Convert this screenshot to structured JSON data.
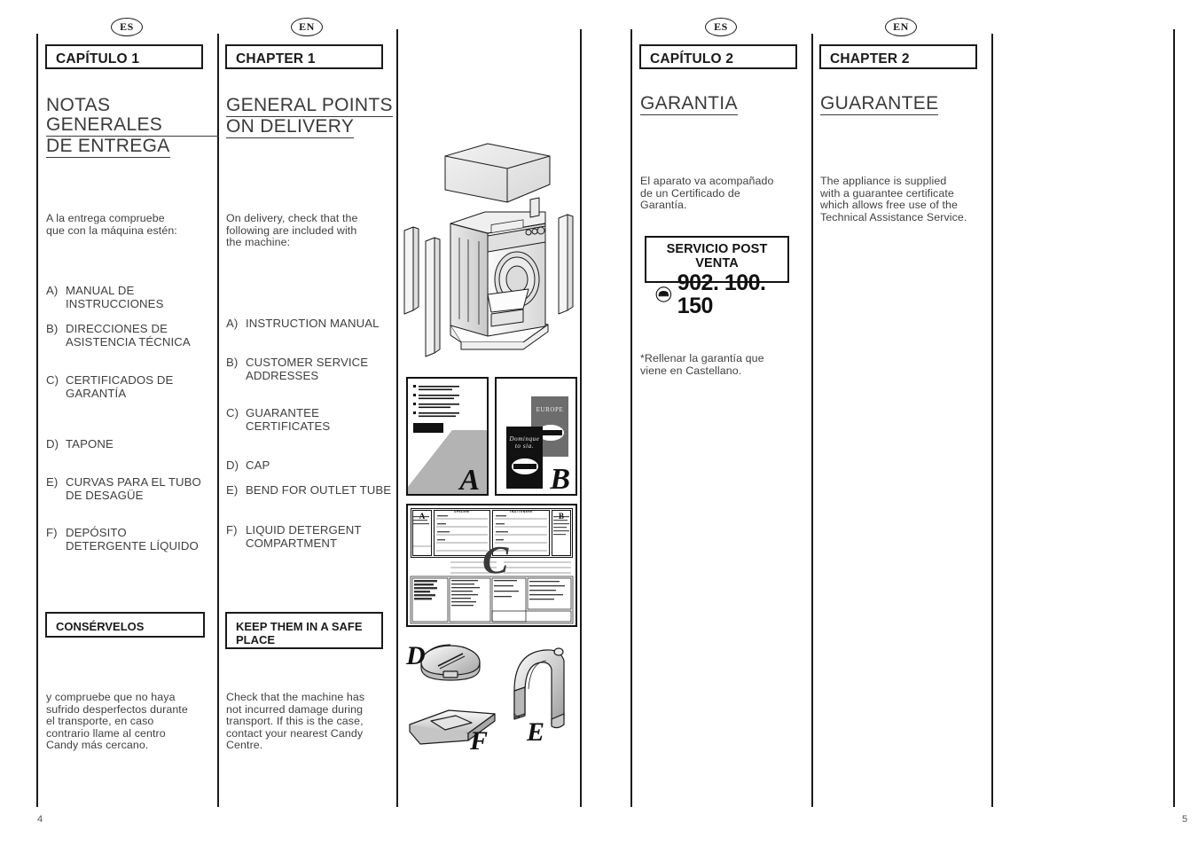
{
  "document": {
    "type": "appliance-instruction-manual-spread",
    "left_page_number": "4",
    "right_page_number": "5"
  },
  "badges": {
    "es": "ES",
    "en": "EN"
  },
  "left_page": {
    "es": {
      "chapter": "CAPÍTULO 1",
      "title_line1": "NOTAS GENERALES",
      "title_line2": "DE ENTREGA",
      "intro": "A la entrega compruebe\nque con la máquina estén:",
      "items": [
        {
          "label": "A)",
          "text": "MANUAL DE\nINSTRUCCIONES"
        },
        {
          "label": "B)",
          "text": "DIRECCIONES DE\nASISTENCIA TÉCNICA"
        },
        {
          "label": "C)",
          "text": "CERTIFICADOS DE\nGARANTÍA"
        },
        {
          "label": "D)",
          "text": "TAPONE"
        },
        {
          "label": "E)",
          "text": "CURVAS PARA EL TUBO\nDE DESAGÜE"
        },
        {
          "label": "F)",
          "text": "DEPÓSITO\nDETERGENTE LÍQUIDO"
        }
      ],
      "keep_box": "CONSÉRVELOS",
      "closing": "y compruebe que no haya\nsufrido desperfectos durante\nel transporte, en caso\ncontrario llame al centro\nCandy más cercano."
    },
    "en": {
      "chapter": "CHAPTER 1",
      "title_line1": "GENERAL POINTS",
      "title_line2": "ON DELIVERY",
      "intro": "On delivery, check that the\nfollowing are included with\nthe machine:",
      "items": [
        {
          "label": "A)",
          "text": "INSTRUCTION MANUAL"
        },
        {
          "label": "B)",
          "text": "CUSTOMER SERVICE\nADDRESSES"
        },
        {
          "label": "C)",
          "text": "GUARANTEE\nCERTIFICATES"
        },
        {
          "label": "D)",
          "text": "CAP"
        },
        {
          "label": "E)",
          "text": "BEND FOR OUTLET TUBE"
        },
        {
          "label": "F)",
          "text": "LIQUID DETERGENT\nCOMPARTMENT"
        }
      ],
      "keep_box": "KEEP THEM IN A SAFE\nPLACE",
      "closing": "Check that the machine has\nnot incurred damage during\ntransport. If this is the case,\ncontact your nearest Candy\nCentre."
    },
    "illustrations": {
      "machine_caption": "",
      "labels": {
        "a": "A",
        "b": "B",
        "c": "C",
        "d": "D",
        "e": "E",
        "f": "F"
      },
      "card_europe": "EUROPE",
      "card_dominque": "Dominque\nto sia.",
      "form_header_left": "SPEDIRE",
      "form_header_right": "TRATTENERE",
      "form_box_a": "A",
      "form_box_b": "B"
    }
  },
  "right_page": {
    "es": {
      "chapter": "CAPÍTULO 2",
      "title": "GARANTIA",
      "body": "El aparato va acompañado\nde un Certificado de\nGarantía.",
      "service_box": {
        "title": "SERVICIO POST VENTA",
        "phone": "902. 100. 150",
        "icon": "telephone-icon"
      },
      "footnote": "*Rellenar la garantía que\nviene en Castellano."
    },
    "en": {
      "chapter": "CHAPTER 2",
      "title": "GUARANTEE",
      "body": "The appliance is supplied\nwith a guarantee certificate\nwhich allows free use of the\nTechnical Assistance Service."
    }
  },
  "colors": {
    "ink": "#1a1a1a",
    "body_text": "#3f3f3f",
    "paper": "#ffffff",
    "illustration_gray": "#b3b3b3",
    "dark_card": "#111111"
  }
}
